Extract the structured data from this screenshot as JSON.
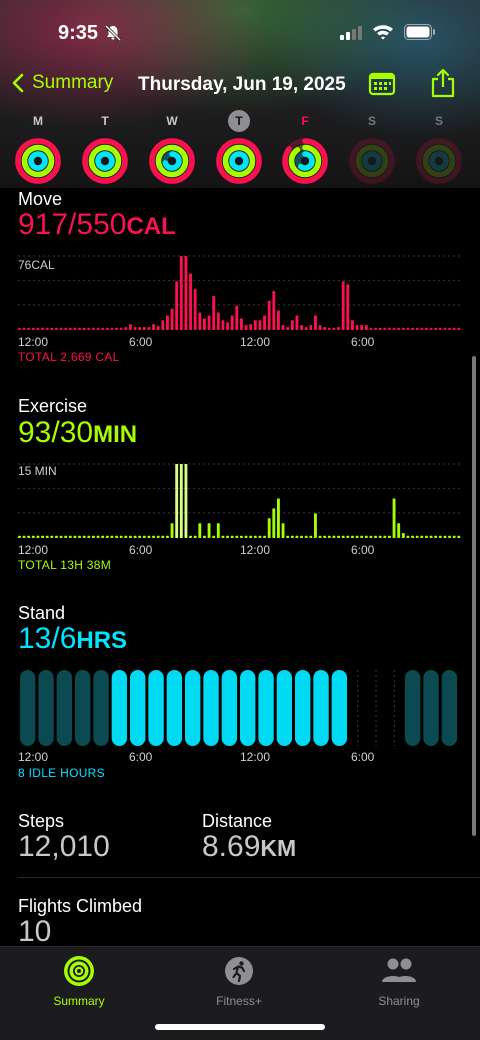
{
  "status_bar": {
    "time": "9:35"
  },
  "nav": {
    "back_label": "Summary",
    "title": "Thursday, Jun 19, 2025"
  },
  "week": [
    {
      "label": "M",
      "move": 1.0,
      "exercise": 1.0,
      "stand": 1.0,
      "state": "past"
    },
    {
      "label": "T",
      "move": 1.0,
      "exercise": 1.0,
      "stand": 1.0,
      "state": "past"
    },
    {
      "label": "W",
      "move": 1.0,
      "exercise": 1.0,
      "stand": 0.7,
      "state": "past"
    },
    {
      "label": "T",
      "move": 1.0,
      "exercise": 1.0,
      "stand": 1.0,
      "state": "today"
    },
    {
      "label": "F",
      "move": 0.85,
      "exercise": 0.9,
      "stand": 0.6,
      "state": "past-red"
    },
    {
      "label": "S",
      "move": 0.0,
      "exercise": 0.0,
      "stand": 0.0,
      "state": "future"
    },
    {
      "label": "S",
      "move": 0.0,
      "exercise": 0.0,
      "stand": 0.0,
      "state": "future"
    }
  ],
  "colors": {
    "move": "#fa114f",
    "exercise": "#a6ff00",
    "stand": "#00e5ff",
    "accent": "#a6ff00"
  },
  "move": {
    "title": "Move",
    "value": "917/550",
    "unit": "CAL",
    "max_label": "76CAL",
    "total": "TOTAL 2,669 CAL",
    "axis": [
      "12:00",
      "6:00",
      "12:00",
      "6:00"
    ],
    "bars": [
      2,
      2,
      2,
      2,
      2,
      2,
      2,
      2,
      2,
      2,
      2,
      2,
      2,
      2,
      2,
      2,
      2,
      2,
      2,
      2,
      2,
      2,
      2,
      3,
      6,
      3,
      3,
      3,
      3,
      6,
      4,
      10,
      15,
      22,
      50,
      76,
      76,
      58,
      42,
      18,
      12,
      15,
      35,
      18,
      10,
      8,
      15,
      25,
      12,
      5,
      6,
      10,
      10,
      15,
      30,
      40,
      20,
      5,
      3,
      10,
      15,
      5,
      3,
      5,
      15,
      5,
      3,
      2,
      2,
      3,
      50,
      47,
      10,
      5,
      5,
      5,
      2,
      2,
      2,
      2,
      2,
      2,
      2,
      2,
      2,
      2,
      2,
      2,
      2,
      2,
      2,
      2,
      2,
      2,
      2,
      2
    ]
  },
  "exercise": {
    "title": "Exercise",
    "value": "93/30",
    "unit": "MIN",
    "max_label": "15 MIN",
    "total": "TOTAL 13H 38M",
    "axis": [
      "12:00",
      "6:00",
      "12:00",
      "6:00"
    ],
    "bars": [
      0,
      0,
      0,
      0,
      0,
      0,
      0,
      0,
      0,
      0,
      0,
      0,
      0,
      0,
      0,
      0,
      0,
      0,
      0,
      0,
      0,
      0,
      0,
      0,
      0,
      0,
      0,
      0,
      0,
      0,
      0,
      0,
      0,
      3,
      15,
      15,
      15,
      0,
      0,
      3,
      0,
      3,
      0,
      3,
      0,
      0,
      0,
      0,
      0,
      0,
      0,
      0,
      0,
      0,
      4,
      6,
      8,
      3,
      0,
      0,
      0,
      0,
      0,
      0,
      5,
      0,
      0,
      0,
      0,
      0,
      0,
      0,
      0,
      0,
      0,
      0,
      0,
      0,
      0,
      0,
      0,
      8,
      3,
      1,
      0,
      0,
      0,
      0,
      0,
      0,
      0,
      0,
      0,
      0,
      0,
      0
    ]
  },
  "stand": {
    "title": "Stand",
    "value": "13/6",
    "unit": "HRS",
    "idle": "8 IDLE HOURS",
    "axis": [
      "12:00",
      "6:00",
      "12:00",
      "6:00"
    ],
    "hours": [
      "idle",
      "idle",
      "idle",
      "idle",
      "idle",
      "stood",
      "stood",
      "stood",
      "stood",
      "stood",
      "stood",
      "stood",
      "stood",
      "stood",
      "stood",
      "stood",
      "stood",
      "stood",
      "empty",
      "empty",
      "empty",
      "idle",
      "idle",
      "idle"
    ]
  },
  "stats": {
    "steps_label": "Steps",
    "steps_value": "12,010",
    "distance_label": "Distance",
    "distance_value": "8.69",
    "distance_unit": "KM",
    "flights_label": "Flights Climbed",
    "flights_value": "10"
  },
  "tabs": [
    {
      "label": "Summary",
      "icon": "activity-rings-icon",
      "selected": true
    },
    {
      "label": "Fitness+",
      "icon": "running-figure-icon",
      "selected": false
    },
    {
      "label": "Sharing",
      "icon": "people-icon",
      "selected": false
    }
  ]
}
